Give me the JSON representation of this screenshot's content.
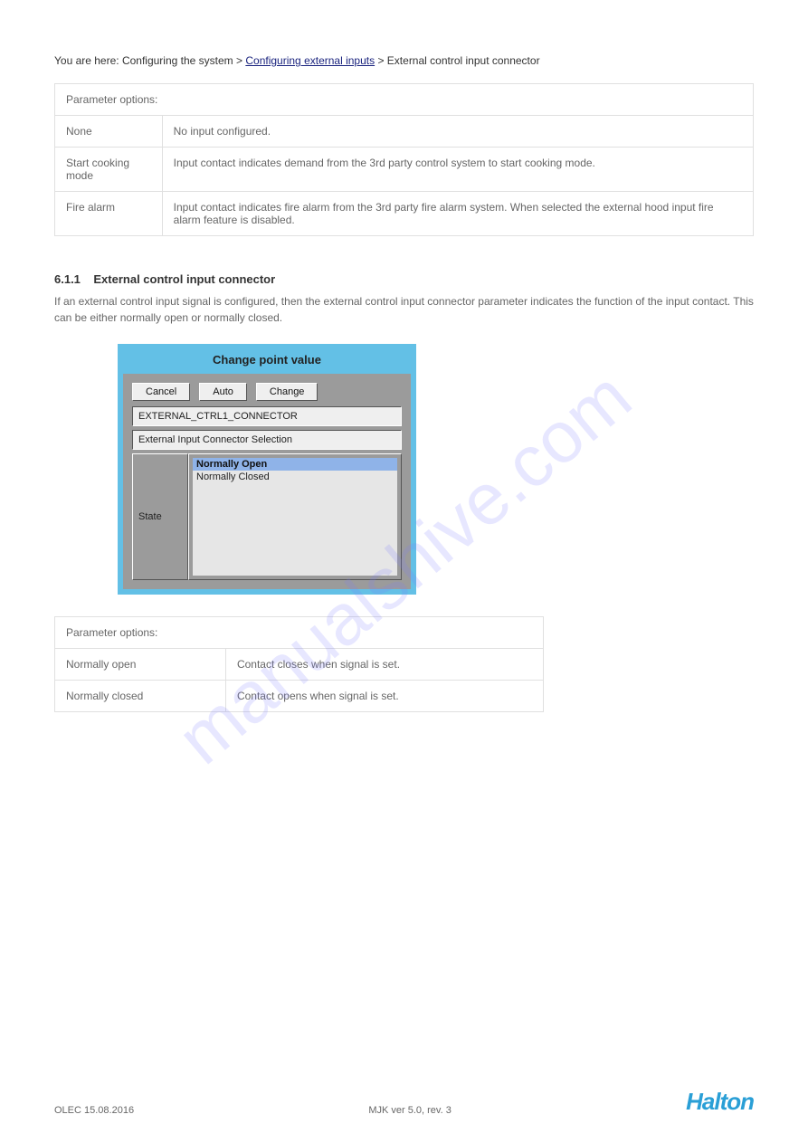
{
  "breadcrumb": {
    "prefix": "You are here: Configuring the system > ",
    "link": "Configuring external inputs",
    "suffix": " > External control input connector"
  },
  "table1": {
    "header": "Parameter options:",
    "rows": [
      {
        "k": "None",
        "v": "No input configured."
      },
      {
        "k": "Start cooking mode",
        "v": "Input contact indicates demand from the 3rd party control system to start cooking mode."
      },
      {
        "k": "Fire alarm",
        "v": "Input contact indicates fire alarm from the 3rd party fire alarm system. When selected the external hood input fire alarm feature is disabled."
      }
    ]
  },
  "section": {
    "number": "6.1.1",
    "title": "External control input connector",
    "desc": "If an external control input signal is configured, then the external control input connector parameter indicates the function of the input contact. This can be either normally open or normally closed."
  },
  "dialog": {
    "title": "Change point value",
    "buttons": {
      "cancel": "Cancel",
      "auto": "Auto",
      "change": "Change"
    },
    "field1": "EXTERNAL_CTRL1_CONNECTOR",
    "field2": "External Input Connector Selection",
    "state_label": "State",
    "options": [
      {
        "label": "Normally Open",
        "selected": true
      },
      {
        "label": "Normally Closed",
        "selected": false
      }
    ]
  },
  "table2": {
    "header": "Parameter options:",
    "rows": [
      {
        "k": "Normally open",
        "v": "Contact closes when signal is set."
      },
      {
        "k": "Normally closed",
        "v": "Contact opens when signal is set."
      }
    ]
  },
  "footer": {
    "left": "OLEC 15.08.2016",
    "center": "MJK ver 5.0, rev. 3"
  },
  "logo": "Halton",
  "watermark": "manualshive.com"
}
